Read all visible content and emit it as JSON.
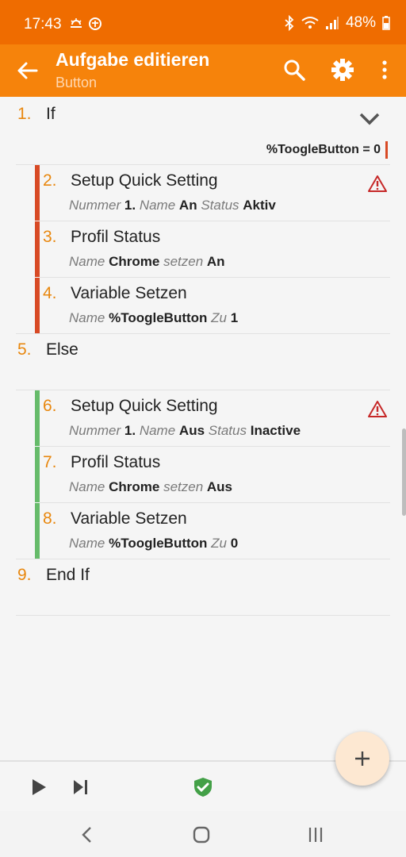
{
  "status_bar": {
    "time": "17:43",
    "battery": "48%"
  },
  "app_bar": {
    "title": "Aufgabe editieren",
    "subtitle": "Button"
  },
  "actions": [
    {
      "num": "1.",
      "name": "If",
      "condition": "%ToogleButton = 0"
    },
    {
      "num": "2.",
      "name": "Setup Quick Setting",
      "params": [
        [
          "Nummer",
          "1."
        ],
        [
          "Name",
          "An"
        ],
        [
          "Status",
          "Aktiv"
        ]
      ],
      "warning": true
    },
    {
      "num": "3.",
      "name": "Profil Status",
      "params": [
        [
          "Name",
          "Chrome"
        ],
        [
          "setzen",
          "An"
        ]
      ]
    },
    {
      "num": "4.",
      "name": "Variable Setzen",
      "params": [
        [
          "Name",
          "%ToogleButton"
        ],
        [
          "Zu",
          "1"
        ]
      ]
    },
    {
      "num": "5.",
      "name": "Else"
    },
    {
      "num": "6.",
      "name": "Setup Quick Setting",
      "params": [
        [
          "Nummer",
          "1."
        ],
        [
          "Name",
          "Aus"
        ],
        [
          "Status",
          "Inactive"
        ]
      ],
      "warning": true
    },
    {
      "num": "7.",
      "name": "Profil Status",
      "params": [
        [
          "Name",
          "Chrome"
        ],
        [
          "setzen",
          "Aus"
        ]
      ]
    },
    {
      "num": "8.",
      "name": "Variable Setzen",
      "params": [
        [
          "Name",
          "%ToogleButton"
        ],
        [
          "Zu",
          "0"
        ]
      ]
    },
    {
      "num": "9.",
      "name": "End If"
    }
  ],
  "colors": {
    "accent": "#f6830b",
    "status_bar": "#ef6c00",
    "if_branch": "#d84a25",
    "else_branch": "#66bb6a",
    "number": "#e8870e"
  },
  "icons": [
    "back-arrow-icon",
    "search-icon",
    "gear-icon",
    "more-vert-icon",
    "chevron-down-icon",
    "warning-icon",
    "play-icon",
    "skip-next-icon",
    "shield-check-icon",
    "plus-icon",
    "nav-back-icon",
    "nav-home-icon",
    "nav-recents-icon"
  ]
}
